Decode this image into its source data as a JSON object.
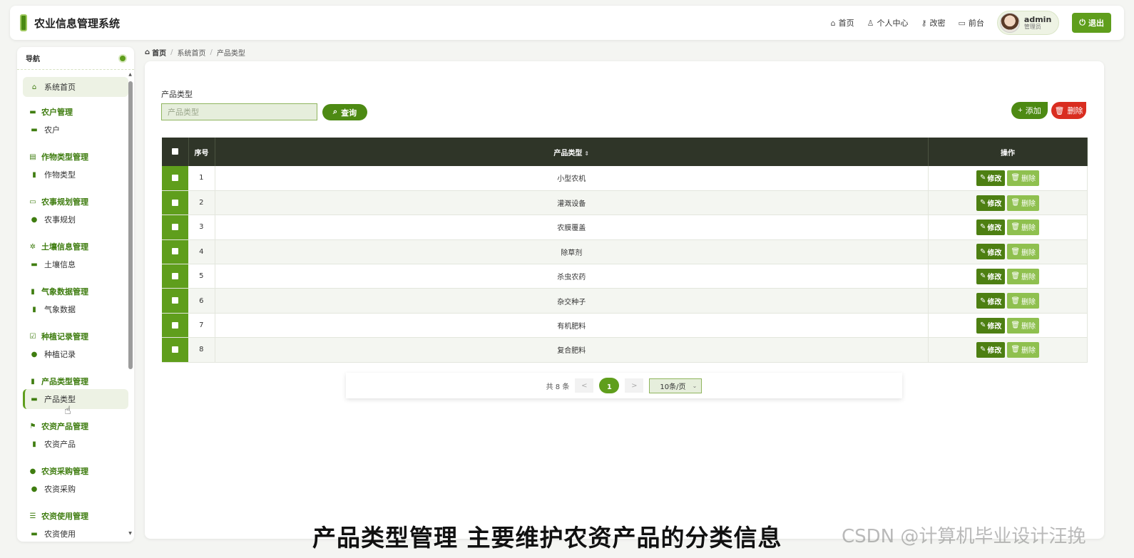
{
  "header": {
    "title": "农业信息管理系统",
    "nav": [
      {
        "icon": "home-icon",
        "label": "首页"
      },
      {
        "icon": "user-icon",
        "label": "个人中心"
      },
      {
        "icon": "key-icon",
        "label": "改密"
      },
      {
        "icon": "monitor-icon",
        "label": "前台"
      }
    ],
    "user": {
      "name": "admin",
      "role": "管理员"
    },
    "logout_label": "退出"
  },
  "sidebar": {
    "title": "导航",
    "home_label": "系统首页",
    "groups": [
      {
        "title": "农户管理",
        "item": "农户"
      },
      {
        "title": "作物类型管理",
        "item": "作物类型"
      },
      {
        "title": "农事规划管理",
        "item": "农事规划"
      },
      {
        "title": "土壤信息管理",
        "item": "土壤信息"
      },
      {
        "title": "气象数据管理",
        "item": "气象数据"
      },
      {
        "title": "种植记录管理",
        "item": "种植记录"
      },
      {
        "title": "产品类型管理",
        "item": "产品类型"
      },
      {
        "title": "农资产品管理",
        "item": "农资产品"
      },
      {
        "title": "农资采购管理",
        "item": "农资采购"
      },
      {
        "title": "农资使用管理",
        "item": "农资使用"
      }
    ],
    "active_item": "产品类型"
  },
  "breadcrumb": [
    "首页",
    "系统首页",
    "产品类型"
  ],
  "filter": {
    "label": "产品类型",
    "placeholder": "产品类型",
    "query_label": "查询"
  },
  "actions": {
    "add_label": "添加",
    "delete_label": "删除"
  },
  "table": {
    "headers": {
      "index": "序号",
      "type": "产品类型",
      "ops": "操作"
    },
    "edit_label": "修改",
    "delete_label": "删除",
    "rows": [
      {
        "index": "1",
        "type": "小型农机"
      },
      {
        "index": "2",
        "type": "灌溉设备"
      },
      {
        "index": "3",
        "type": "农膜覆盖"
      },
      {
        "index": "4",
        "type": "除草剂"
      },
      {
        "index": "5",
        "type": "杀虫农药"
      },
      {
        "index": "6",
        "type": "杂交种子"
      },
      {
        "index": "7",
        "type": "有机肥料"
      },
      {
        "index": "8",
        "type": "复合肥料"
      }
    ]
  },
  "pagination": {
    "total_text": "共 8 条",
    "prev": "<",
    "current": "1",
    "next": ">",
    "page_size": "10条/页"
  },
  "caption": "产品类型管理 主要维护农资产品的分类信息",
  "watermark": "CSDN @计算机毕业设计汪挽",
  "colors": {
    "accent": "#5f9e1c",
    "dark": "#2f3528",
    "danger": "#d92d20"
  }
}
